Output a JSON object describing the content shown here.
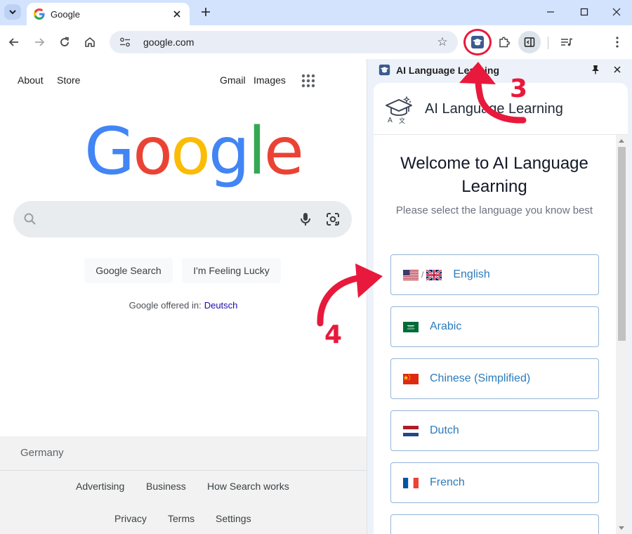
{
  "browser": {
    "tab": {
      "title": "Google"
    },
    "omnibox": {
      "url": "google.com"
    }
  },
  "google": {
    "nav_left": [
      "About",
      "Store"
    ],
    "nav_right": [
      "Gmail",
      "Images"
    ],
    "logo_letters": [
      {
        "char": "G",
        "color": "#4285F4"
      },
      {
        "char": "o",
        "color": "#EA4335"
      },
      {
        "char": "o",
        "color": "#FBBC05"
      },
      {
        "char": "g",
        "color": "#4285F4"
      },
      {
        "char": "l",
        "color": "#34A853"
      },
      {
        "char": "e",
        "color": "#EA4335"
      }
    ],
    "search_button": "Google Search",
    "lucky_button": "I'm Feeling Lucky",
    "offered_in": "Google offered in:",
    "offered_language": "Deutsch",
    "footer": {
      "country": "Germany",
      "row1": [
        "Advertising",
        "Business",
        "How Search works"
      ],
      "row2": [
        "Privacy",
        "Terms",
        "Settings"
      ]
    }
  },
  "side_panel": {
    "title": "AI Language Learning",
    "app_title": "AI Language Learning",
    "welcome": "Welcome to AI Language Learning",
    "subtitle": "Please select the language you know best",
    "flag_separator": "/",
    "languages": [
      {
        "label": "English",
        "flags": [
          "us-flag",
          "uk-flag"
        ]
      },
      {
        "label": "Arabic",
        "flags": [
          "saudi-flag"
        ]
      },
      {
        "label": "Chinese (Simplified)",
        "flags": [
          "china-flag"
        ]
      },
      {
        "label": "Dutch",
        "flags": [
          "netherlands-flag"
        ]
      },
      {
        "label": "French",
        "flags": [
          "france-flag"
        ]
      }
    ]
  },
  "annotations": {
    "step_3": "3",
    "step_4": "4",
    "accent_color": "#e8193c"
  }
}
